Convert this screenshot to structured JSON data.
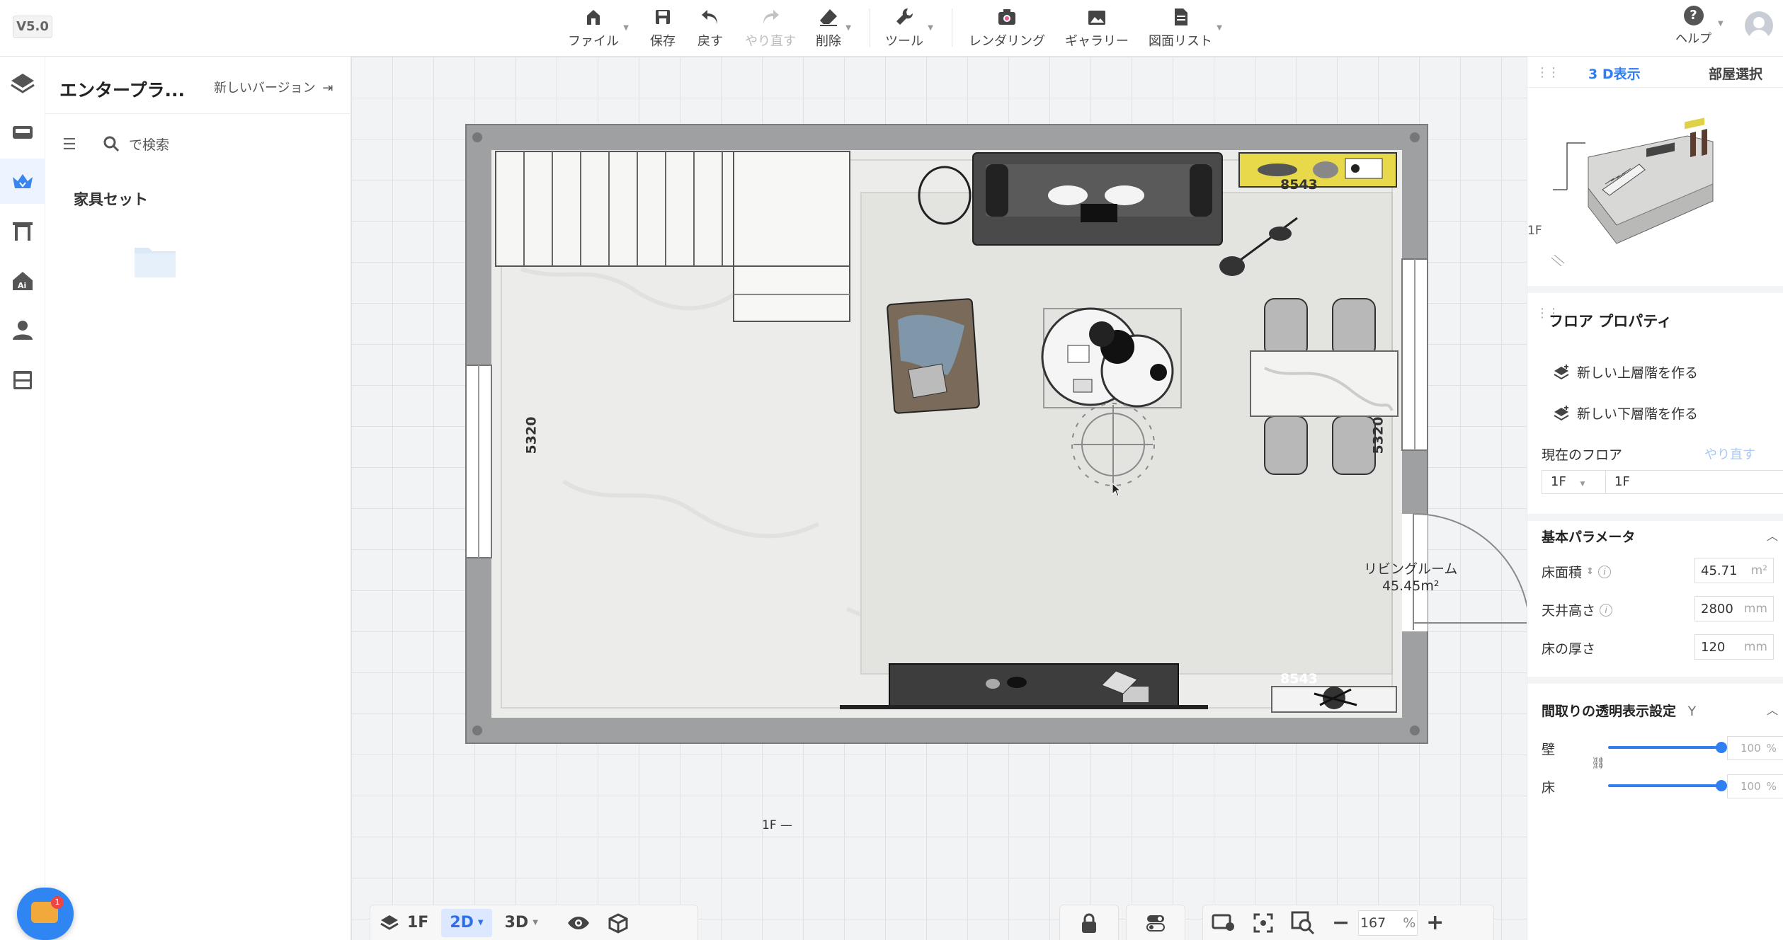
{
  "app": {
    "version": "V5.0"
  },
  "toolbar": {
    "file": "ファイル",
    "save": "保存",
    "undo": "戻す",
    "redo": "やり直す",
    "delete": "削除",
    "tools": "ツール",
    "rendering": "レンダリング",
    "gallery": "ギャラリー",
    "drawing_list": "図面リスト",
    "help": "ヘルプ"
  },
  "left_panel": {
    "title": "エンタープラ...",
    "new_version": "新しいバージョン",
    "search_placeholder": "で検索",
    "section": "家具セット"
  },
  "canvas": {
    "room_name": "リビングルーム",
    "room_area": "45.45m²",
    "dim_top_label": "8543",
    "dim_bottom_label": "8543",
    "dim_left_label": "5320",
    "dim_right_label": "5320",
    "floor_tag": "1F —"
  },
  "bottom_bar": {
    "floor": "1F",
    "mode_2d": "2D",
    "mode_3d": "3D",
    "zoom": "167",
    "zoom_unit": "%"
  },
  "right_panel": {
    "tab_3d": "3 D表示",
    "tab_room_select": "部屋選択",
    "preview_floor": "1F",
    "floor_properties": "フロア プロパティ",
    "new_upper_floor": "新しい上層階を作る",
    "new_lower_floor": "新しい下層階を作る",
    "current_floor": "現在のフロア",
    "redo": "やり直す",
    "floor_select": "1F",
    "floor_name": "1F",
    "basic_params": "基本パラメータ",
    "floor_area_label": "床面積",
    "floor_area": "45.71",
    "floor_area_unit": "m²",
    "ceiling_height_label": "天井高さ",
    "ceiling_height": "2800",
    "ceiling_height_unit": "mm",
    "floor_thickness_label": "床の厚さ",
    "floor_thickness": "120",
    "floor_thickness_unit": "mm",
    "transparency_settings": "間取りの透明表示設定",
    "transparency_key": "Y",
    "wall_label": "壁",
    "wall_opacity": "100",
    "floor_label": "床",
    "floor_opacity": "100",
    "pct": "%"
  },
  "chat": {
    "badge": "1"
  }
}
